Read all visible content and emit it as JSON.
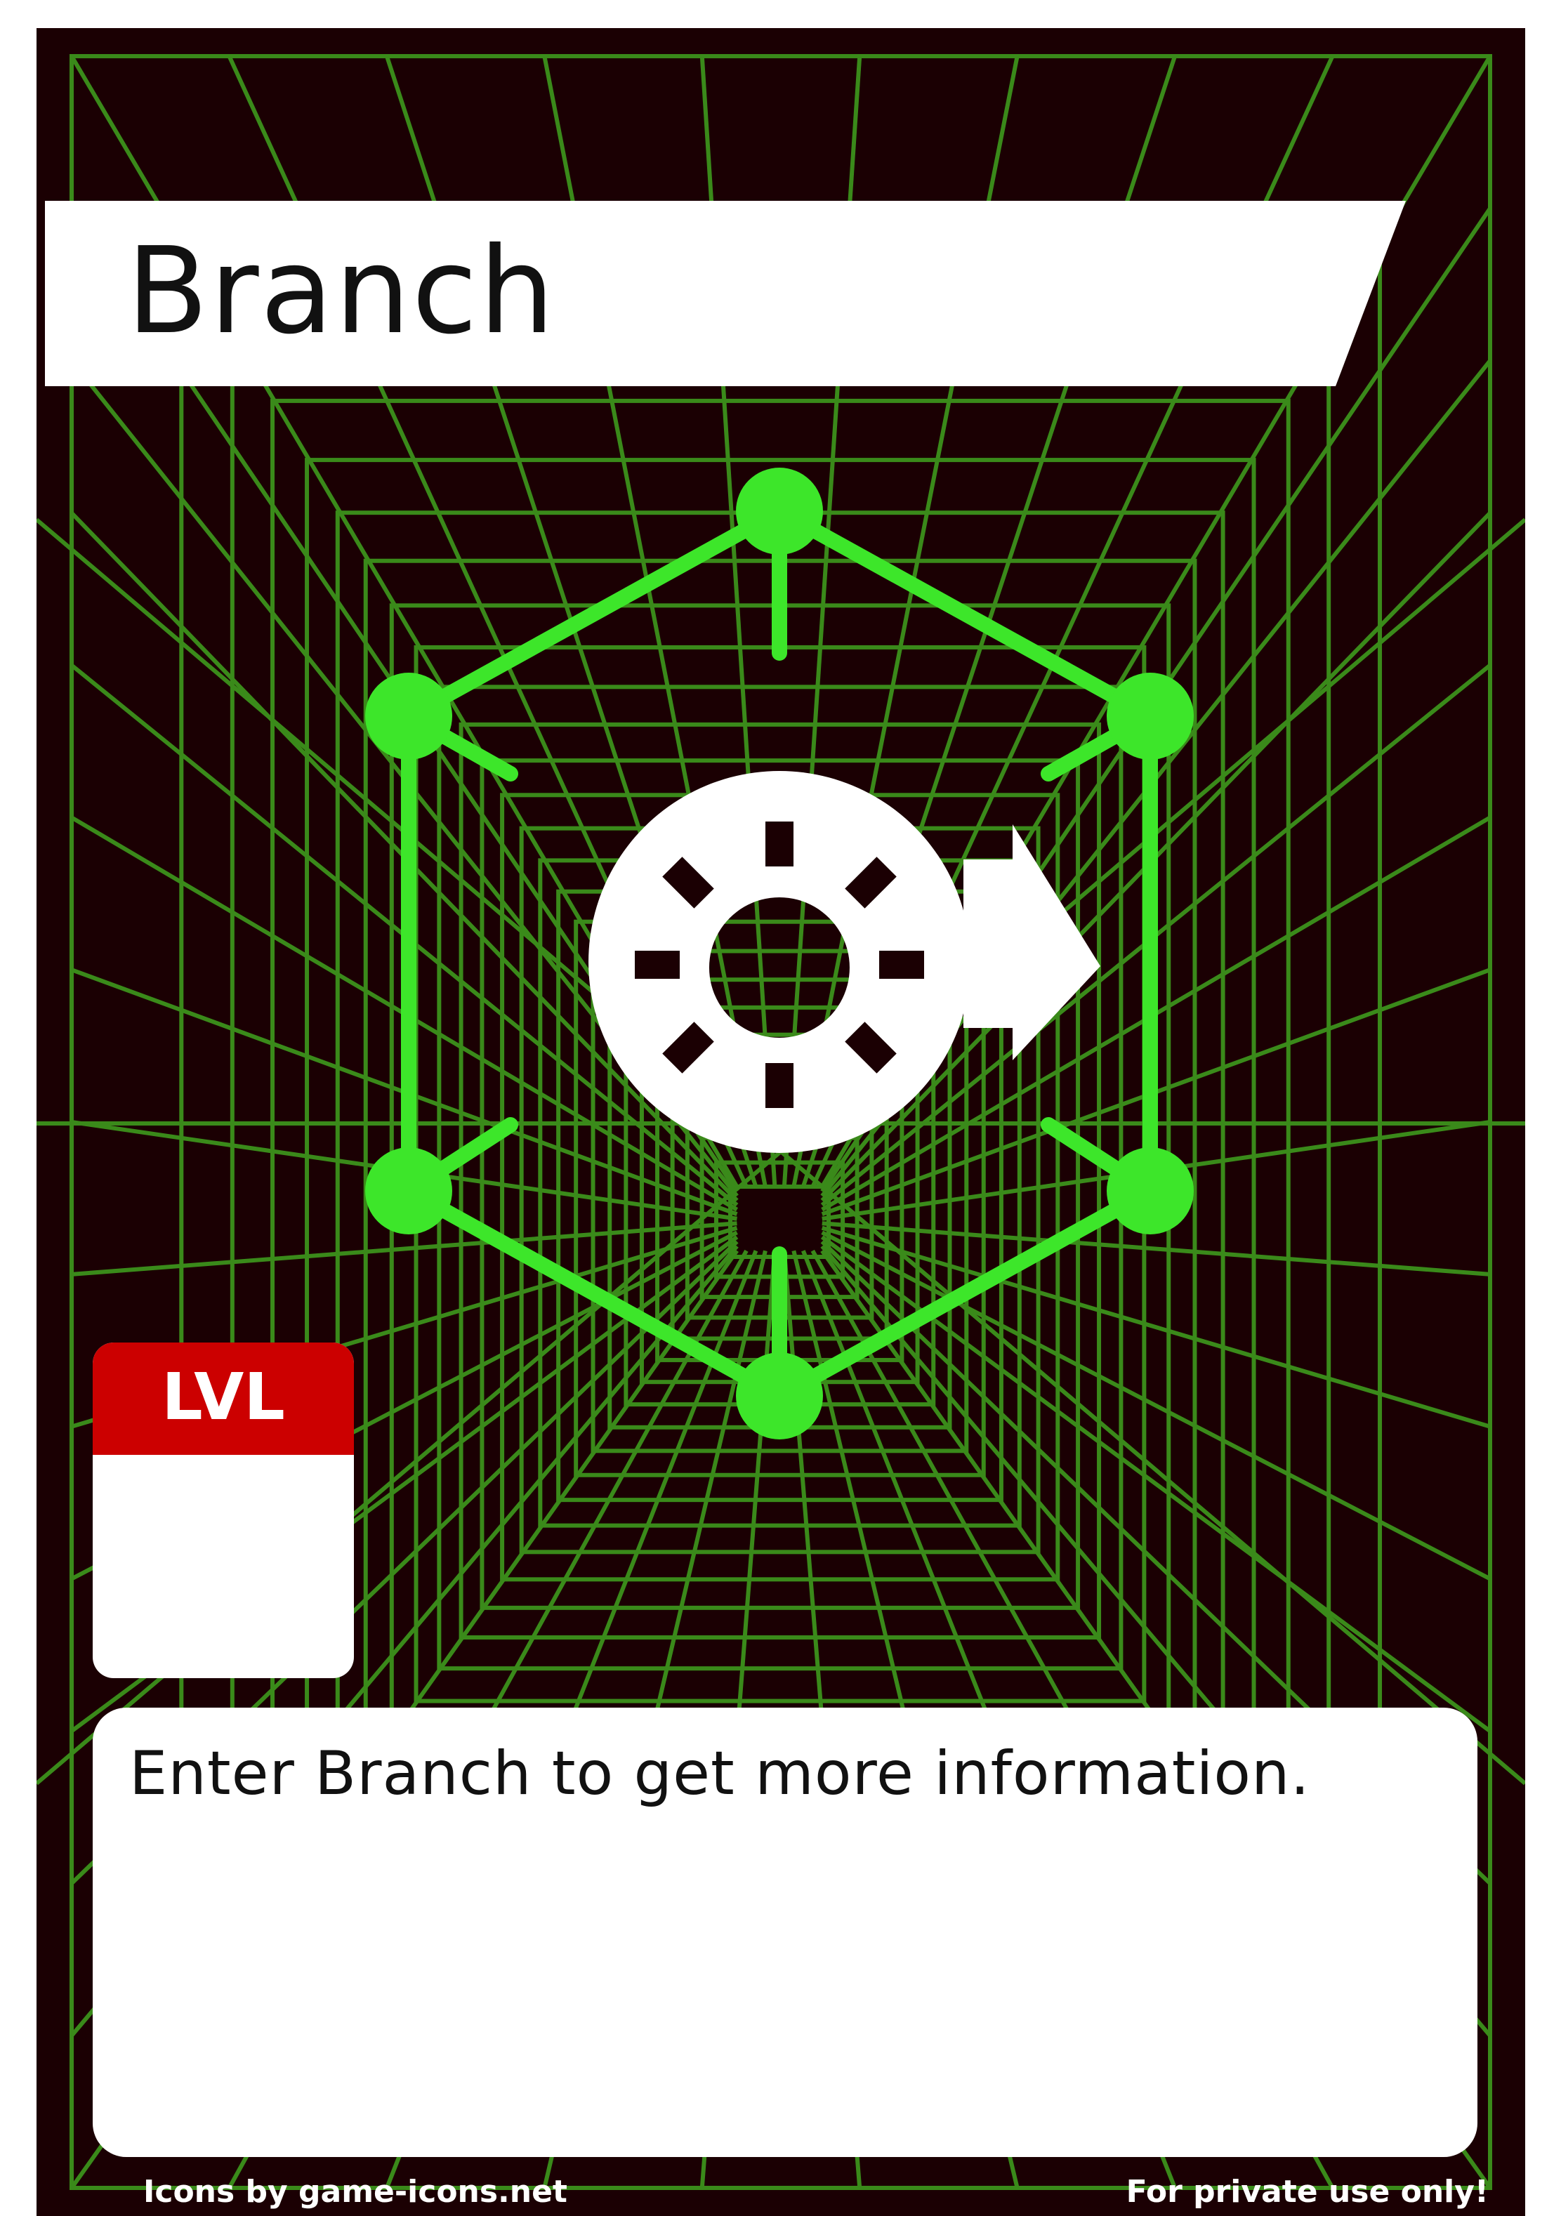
{
  "card": {
    "title": "Branch",
    "level_label": "LVL",
    "level_value": "",
    "description": "Enter Branch to get more information.",
    "footer_left": "Icons by game-icons.net",
    "footer_right": "For private use only!"
  },
  "icon": {
    "central": "portal-exit-arrow-icon",
    "frame": "hexagon-network-icon"
  },
  "colors": {
    "background": "#1b0003",
    "grid": "#3a8a1a",
    "emblem_green": "#3de62a",
    "banner": "#ffffff",
    "level_header": "#cc0000",
    "text_dark": "#111111",
    "text_light": "#ffffff"
  }
}
